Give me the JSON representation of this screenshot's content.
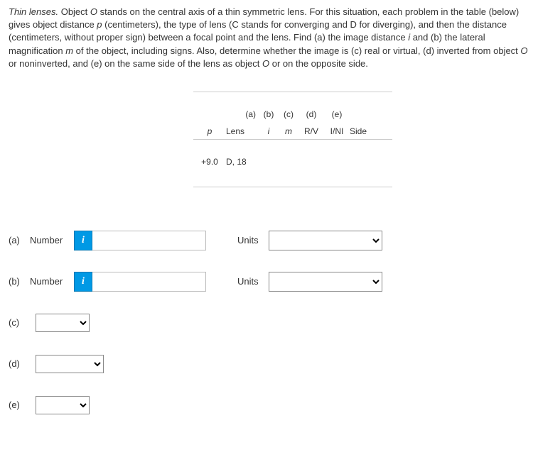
{
  "intro": {
    "lead": "Thin lenses.",
    "body1": " Object ",
    "o1": "O",
    "body2": " stands on the central axis of a thin symmetric lens. For this situation, each problem in the table (below) gives object distance ",
    "p1": "p",
    "body3": " (centimeters), the type of lens (C stands for converging and D for diverging), and then the distance (centimeters, without proper sign) between a focal point and the lens. Find (a) the image distance ",
    "i1": "i",
    "body4": " and (b) the lateral magnification ",
    "m1": "m",
    "body5": " of the object, including signs. Also, determine whether the image is (c) real or virtual, (d) inverted from object ",
    "o2": "O",
    "body6": " or noninverted, and (e) on the same side of the lens as object ",
    "o3": "O",
    "body7": " or on the opposite side."
  },
  "table": {
    "heads": {
      "a": "(a)",
      "b": "(b)",
      "c": "(c)",
      "d": "(d)",
      "e": "(e)"
    },
    "sub": {
      "p": "p",
      "lens": "Lens",
      "i": "i",
      "m": "m",
      "rv": "R/V",
      "ini": "I/NI",
      "side": "Side"
    },
    "data": {
      "p": "+9.0",
      "lens": "D, 18"
    }
  },
  "answers": {
    "a": {
      "label": "(a)",
      "kind": "Number",
      "units": "Units"
    },
    "b": {
      "label": "(b)",
      "kind": "Number",
      "units": "Units"
    },
    "c": {
      "label": "(c)"
    },
    "d": {
      "label": "(d)"
    },
    "e": {
      "label": "(e)"
    }
  }
}
